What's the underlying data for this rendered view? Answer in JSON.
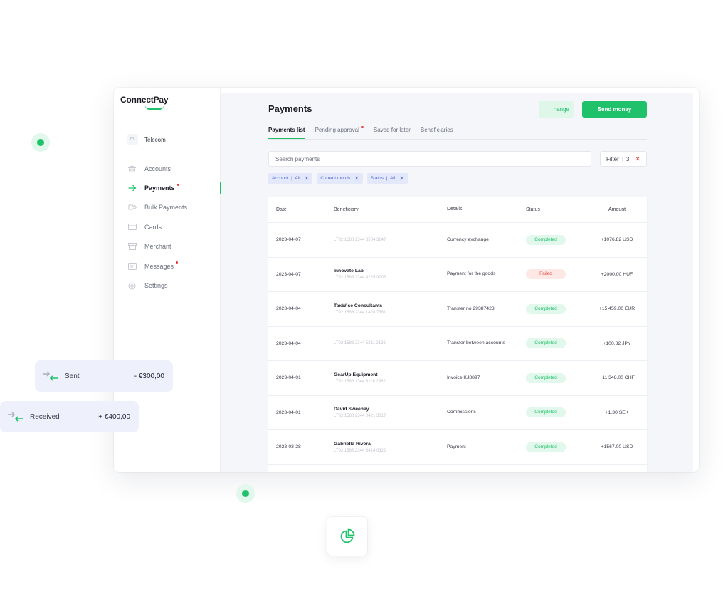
{
  "app": {
    "brand": "ConnectPay"
  },
  "sidebar": {
    "org_badge": "DS",
    "org_name": "Telecom",
    "items": [
      {
        "label": "Accounts"
      },
      {
        "label": "Payments"
      },
      {
        "label": "Bulk Payments"
      },
      {
        "label": "Cards"
      },
      {
        "label": "Merchant"
      },
      {
        "label": "Messages"
      },
      {
        "label": "Settings"
      }
    ]
  },
  "header": {
    "title": "Payments",
    "exchange_label": "nange",
    "send_label": "Send money"
  },
  "tabs": [
    {
      "label": "Payments list"
    },
    {
      "label": "Pending approval"
    },
    {
      "label": "Saved for later"
    },
    {
      "label": "Beneficiaries"
    }
  ],
  "search": {
    "placeholder": "Search payments"
  },
  "filter": {
    "label": "Filter",
    "count": "3"
  },
  "chips": [
    {
      "label": "Account",
      "value": "All"
    },
    {
      "label": "Current month"
    },
    {
      "label": "Status",
      "value": "All"
    }
  ],
  "table": {
    "headers": {
      "date": "Date",
      "beneficiary": "Beneficiary",
      "details": "Details",
      "status": "Status",
      "amount": "Amount"
    },
    "rows": [
      {
        "date": "2023-04-07",
        "name": "",
        "iban": "LT92 1588 2344 8504 3247",
        "details": "Currency exchange",
        "status": "Completed",
        "amount": "+1076.82 USD"
      },
      {
        "date": "2023-04-07",
        "name": "Innovate Lab",
        "iban": "LT92 1588 2344 4225 9203",
        "details": "Payment for the goods",
        "status": "Failed",
        "amount": "+2000.00 HUF"
      },
      {
        "date": "2023-04-04",
        "name": "TaxWise Consultants",
        "iban": "LT92 1588 2344 1428 7381",
        "details": "Transfer no 29387423",
        "status": "Completed",
        "amount": "+15 459.00 EUR"
      },
      {
        "date": "2023-04-04",
        "name": "",
        "iban": "LT92 1588 2344 5211 2136",
        "details": "Transfer between accounts",
        "status": "Completed",
        "amount": "+100.82 JPY"
      },
      {
        "date": "2023-04-01",
        "name": "GearUp Equipment",
        "iban": "LT92 1588 2344 3116 2962",
        "details": "Invoice KJ8897",
        "status": "Completed",
        "amount": "+11 348.00 CHF"
      },
      {
        "date": "2023-04-01",
        "name": "David Sweeney",
        "iban": "LT92 1588 2344 0421 3017",
        "details": "Commissions",
        "status": "Completed",
        "amount": "+1.30 SEK"
      },
      {
        "date": "2023-03-28",
        "name": "Gabriella Rivera",
        "iban": "LT92 1588 2344 3414 0322",
        "details": "Payment",
        "status": "Completed",
        "amount": "+1567.00 USD"
      }
    ]
  },
  "floating_cards": {
    "sent": {
      "label": "Sent",
      "amount": "- €300,00"
    },
    "received": {
      "label": "Received",
      "amount": "+ €400,00"
    }
  },
  "colors": {
    "accent": "#1fc16b",
    "failed": "#e5534b",
    "chip": "#4a64d6"
  }
}
